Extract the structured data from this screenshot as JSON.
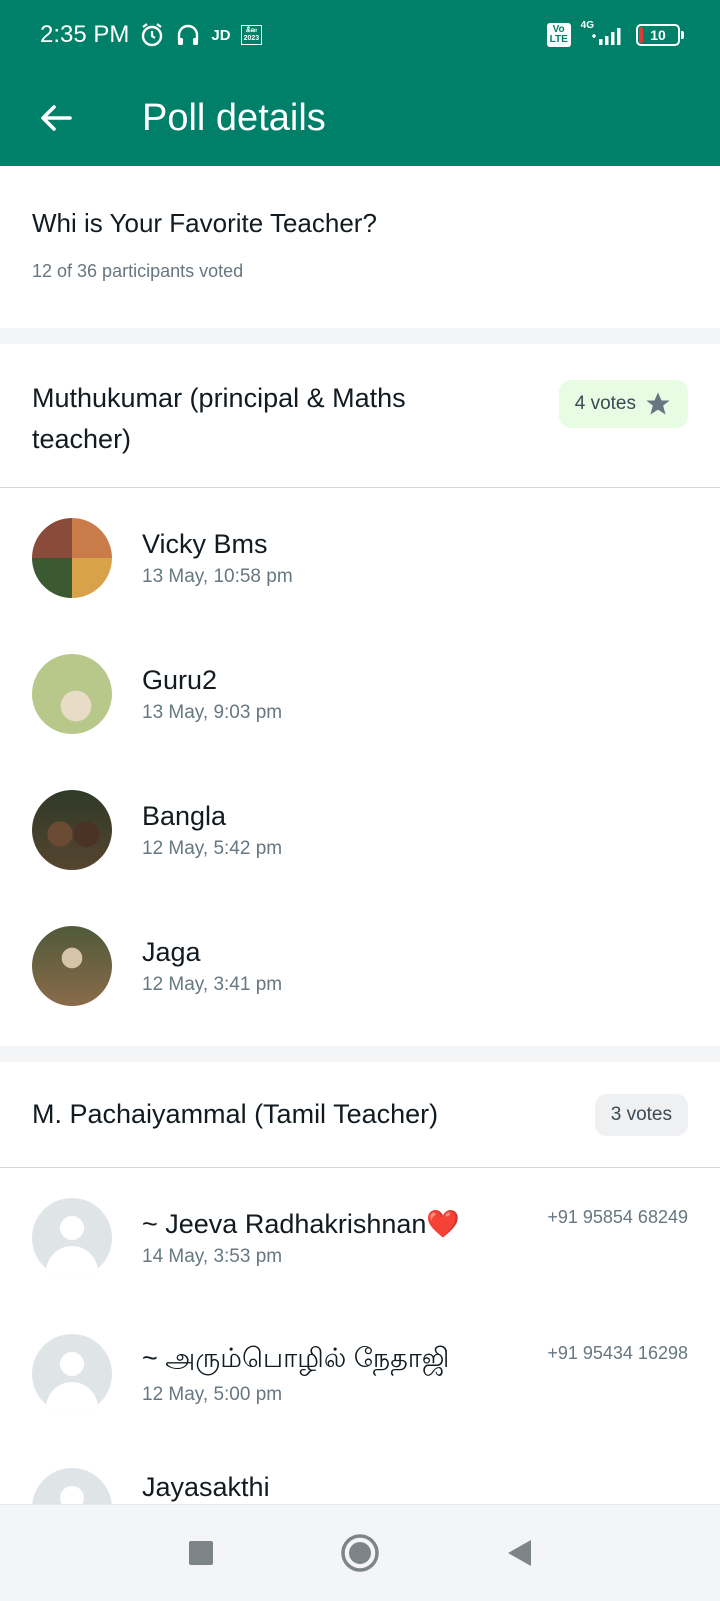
{
  "status": {
    "time": "2:35 PM",
    "jd": "JD",
    "badge_top": "கீன",
    "badge_bottom": "2023",
    "volte": "Vo LTE",
    "network": "4G",
    "battery": "10"
  },
  "toolbar": {
    "title": "Poll details"
  },
  "poll": {
    "question": "Whi is Your Favorite Teacher?",
    "participants": "12 of 36 participants voted"
  },
  "options": [
    {
      "title": "Muthukumar (principal & Maths teacher)",
      "votes": "4 votes",
      "voters": [
        {
          "name": "Vicky Bms",
          "time": "13 May, 10:58 pm"
        },
        {
          "name": "Guru2",
          "time": "13 May, 9:03 pm"
        },
        {
          "name": "Bangla",
          "time": "12 May, 5:42 pm"
        },
        {
          "name": "Jaga",
          "time": "12 May, 3:41 pm"
        }
      ]
    },
    {
      "title": "M. Pachaiyammal (Tamil Teacher)",
      "votes": "3 votes",
      "voters": [
        {
          "name": "~ Jeeva Radhakrishnan❤️",
          "time": "14 May, 3:53 pm",
          "phone": "+91 95854 68249"
        },
        {
          "name": "~ அரும்பொழில் நேதாஜி",
          "time": "12 May, 5:00 pm",
          "phone": "+91 95434 16298"
        },
        {
          "name": "Jayasakthi",
          "time": ""
        }
      ]
    }
  ],
  "colors": {
    "header": "#008069",
    "winner_badge": "#e7fce3"
  }
}
